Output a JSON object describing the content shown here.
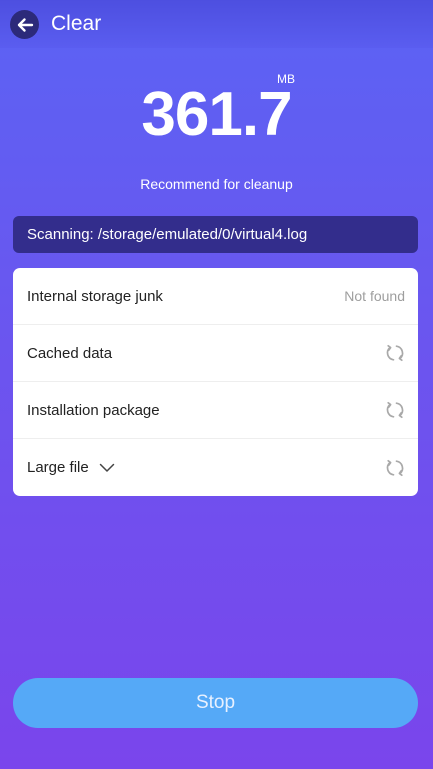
{
  "header": {
    "title": "Clear",
    "back_icon": "arrow-left-icon"
  },
  "summary": {
    "value": "361.7",
    "unit": "MB",
    "caption": "Recommend for cleanup"
  },
  "scan": {
    "text": "Scanning: /storage/emulated/0/virtual4.log"
  },
  "items": [
    {
      "label": "Internal storage junk",
      "status": "Not found",
      "icon": ""
    },
    {
      "label": "Cached data",
      "status": "",
      "icon": "refresh-icon"
    },
    {
      "label": "Installation package",
      "status": "",
      "icon": "refresh-icon"
    },
    {
      "label": "Large file",
      "status": "",
      "icon": "refresh-icon",
      "expand_icon": "chevron-down-icon"
    }
  ],
  "actions": {
    "stop_label": "Stop"
  },
  "colors": {
    "background_top": "#5b63f4",
    "background_bottom": "#7a45ec",
    "scan_bar": "#332d8c",
    "stop_button": "#55a9f7",
    "back_button": "#2c2a7a"
  }
}
